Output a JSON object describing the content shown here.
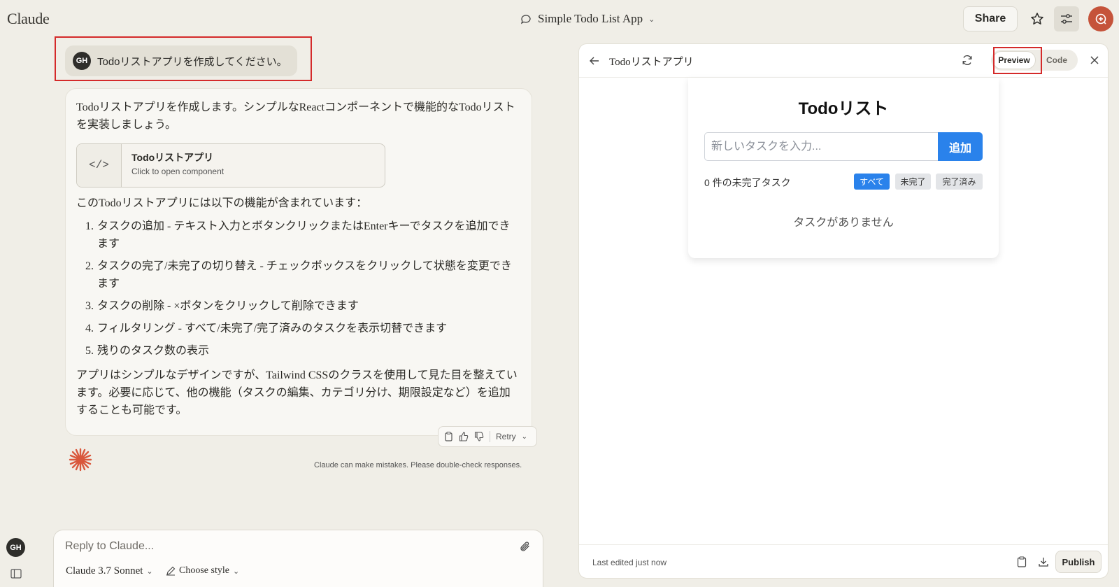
{
  "app": {
    "logo": "Claude"
  },
  "header": {
    "conversation_title": "Simple Todo List App",
    "share_label": "Share",
    "avatar_initials": "GH"
  },
  "chat": {
    "user_message": "Todoリストアプリを作成してください。",
    "user_initials": "GH",
    "assistant": {
      "intro": "Todoリストアプリを作成します。シンプルなReactコンポーネントで機能的なTodoリストを実装しましょう。",
      "artifact_title": "Todoリストアプリ",
      "artifact_subtitle": "Click to open component",
      "artifact_icon": "</>",
      "features_intro": "このTodoリストアプリには以下の機能が含まれています：",
      "features": [
        "タスクの追加 - テキスト入力とボタンクリックまたはEnterキーでタスクを追加できます",
        "タスクの完了/未完了の切り替え - チェックボックスをクリックして状態を変更できます",
        "タスクの削除 - ×ボタンをクリックして削除できます",
        "フィルタリング - すべて/未完了/完了済みのタスクを表示切替できます",
        "残りのタスク数の表示"
      ],
      "outro": "アプリはシンプルなデザインですが、Tailwind CSSのクラスを使用して見た目を整えています。必要に応じて、他の機能（タスクの編集、カテゴリ分け、期限設定など）を追加することも可能です。"
    },
    "retry_label": "Retry",
    "disclaimer": "Claude can make mistakes. Please double-check responses."
  },
  "composer": {
    "placeholder": "Reply to Claude...",
    "model": "Claude 3.7 Sonnet",
    "style": "Choose style"
  },
  "artifact_panel": {
    "title": "Todoリストアプリ",
    "preview_label": "Preview",
    "code_label": "Code",
    "footer_status": "Last edited just now",
    "publish_label": "Publish",
    "todo": {
      "title": "Todoリスト",
      "input_placeholder": "新しいタスクを入力...",
      "add_label": "追加",
      "count_text": "0 件の未完了タスク",
      "filters": [
        "すべて",
        "未完了",
        "完了済み"
      ],
      "active_filter": "すべて",
      "empty_text": "タスクがありません"
    }
  },
  "colors": {
    "background": "#f0eee7",
    "accent_blue": "#2a82eb",
    "claude_orange": "#d9573c",
    "highlight_red": "#d42a2a"
  }
}
